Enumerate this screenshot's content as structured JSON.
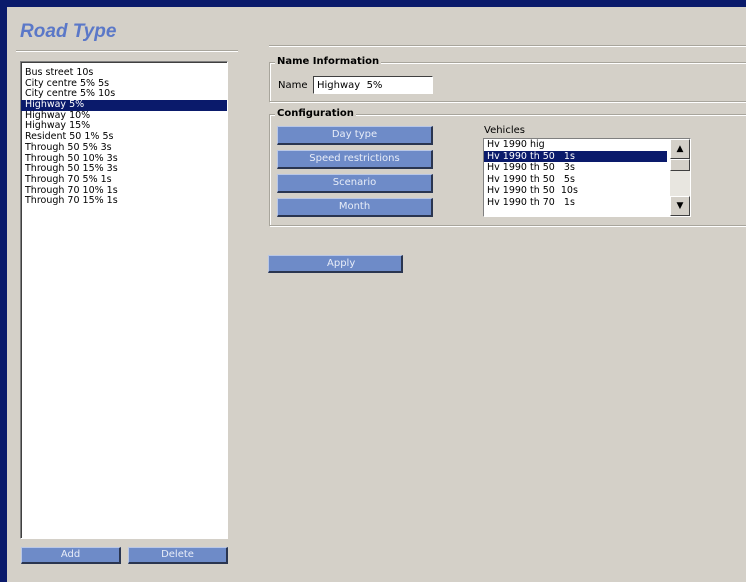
{
  "title": "Road Type",
  "road_types": {
    "items": [
      "Bus street 10s",
      "City centre 5% 5s",
      "City centre 5% 10s",
      "Highway 5%",
      "Highway 10%",
      "Highway 15%",
      "Resident 50 1% 5s",
      "Through 50 5% 3s",
      "Through 50 10% 3s",
      "Through 50 15% 3s",
      "Through 70 5% 1s",
      "Through 70 10% 1s",
      "Through 70 15% 1s"
    ],
    "selected": "Highway 5%"
  },
  "buttons": {
    "add": "Add",
    "delete": "Delete",
    "apply": "Apply"
  },
  "name_info": {
    "legend": "Name Information",
    "label": "Name",
    "value": "Highway  5%"
  },
  "configuration": {
    "legend": "Configuration",
    "buttons": [
      "Day type",
      "Speed restrictions",
      "Scenario",
      "Month"
    ],
    "vehicles_label": "Vehicles",
    "vehicles": [
      "Hv 1990 hig",
      "Hv 1990 th 50   1s",
      "Hv 1990 th 50   3s",
      "Hv 1990 th 50   5s",
      "Hv 1990 th 50  10s",
      "Hv 1990 th 70   1s"
    ],
    "selected_vehicle": "Hv 1990 th 50   1s"
  },
  "colors": {
    "accent": "#6e8bc8",
    "title": "#5b78c8",
    "selection": "#0a1a6b",
    "frame": "#0a1a6b"
  }
}
